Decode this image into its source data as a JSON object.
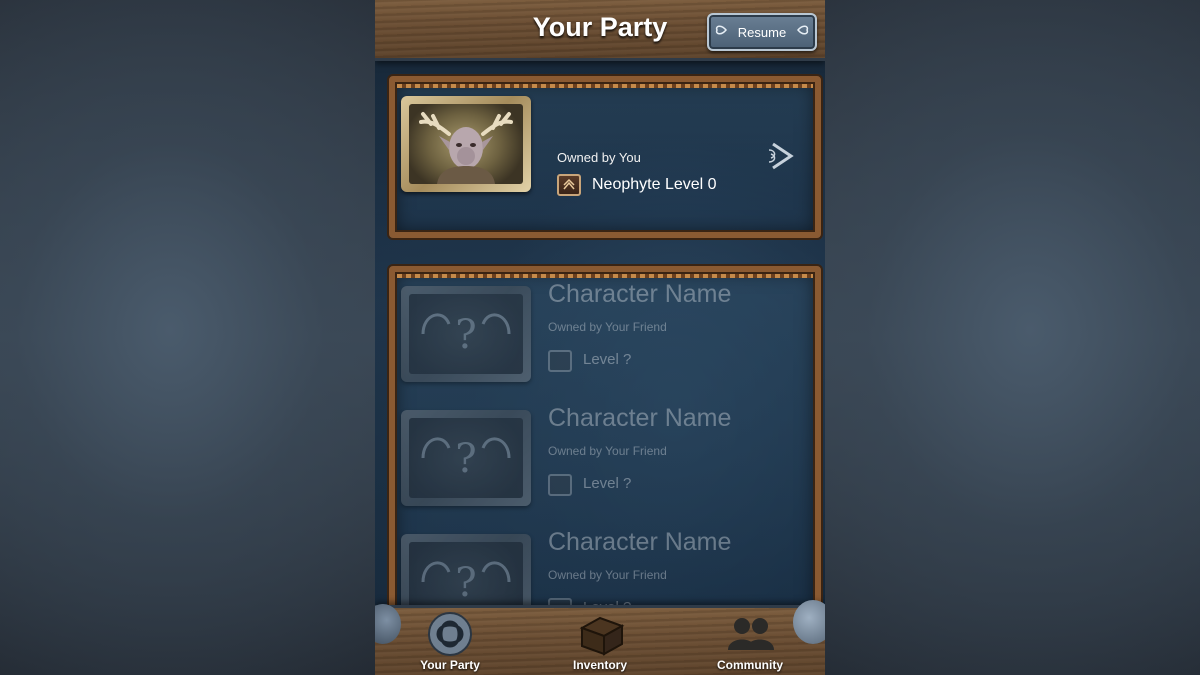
{
  "header": {
    "title": "Your Party",
    "resume_label": "Resume"
  },
  "owned_character": {
    "owner": "Owned by You",
    "level": "Neophyte Level 0"
  },
  "friend_slots": [
    {
      "name": "Character Name",
      "owner": "Owned by Your Friend",
      "level": "Level ?"
    },
    {
      "name": "Character Name",
      "owner": "Owned by Your Friend",
      "level": "Level ?"
    },
    {
      "name": "Character Name",
      "owner": "Owned by Your Friend",
      "level": "Level ?"
    }
  ],
  "tabs": [
    {
      "label": "Your Party",
      "icon": "celtic-knot-icon"
    },
    {
      "label": "Inventory",
      "icon": "chest-icon"
    },
    {
      "label": "Community",
      "icon": "people-icon"
    }
  ],
  "colors": {
    "frame_wood": "#8a5a32",
    "panel_bg": "#2d4b64",
    "title_text": "#ffffff"
  }
}
